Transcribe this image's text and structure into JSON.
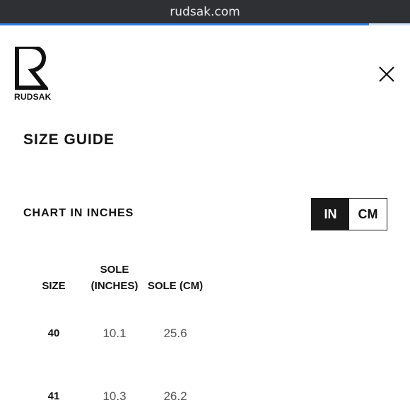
{
  "browser": {
    "url": "rudsak.com",
    "load_progress": 0.9
  },
  "header": {
    "logo_text": "RUDSAK"
  },
  "page": {
    "title": "SIZE GUIDE",
    "chart_label": "CHART IN INCHES",
    "units": {
      "options": [
        "IN",
        "CM"
      ],
      "selected": "IN"
    }
  },
  "table": {
    "headers": {
      "size": "SIZE",
      "sole_in_line1": "SOLE",
      "sole_in_line2": "(INCHES)",
      "sole_cm": "SOLE (CM)"
    },
    "rows": [
      {
        "size": "40",
        "sole_in": "10.1",
        "sole_cm": "25.6"
      },
      {
        "size": "41",
        "sole_in": "10.3",
        "sole_cm": "26.2"
      }
    ]
  },
  "colors": {
    "url_bar_bg": "#2e3034",
    "progress": "#2d7de0",
    "toggle_active_bg": "#1a1a1a"
  }
}
